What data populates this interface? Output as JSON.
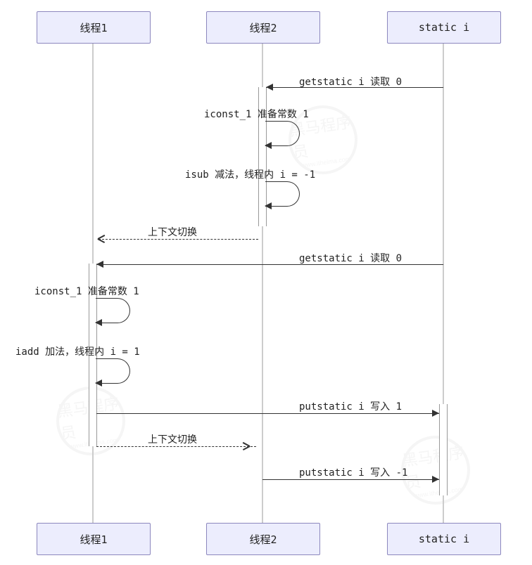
{
  "participants": {
    "p1": "线程1",
    "p2": "线程2",
    "p3": "static i"
  },
  "messages": {
    "m1": "getstatic i 读取 0",
    "m2": "iconst_1 准备常数 1",
    "m3": "isub 减法，线程内 i = -1",
    "m4": "上下文切换",
    "m5": "getstatic i 读取 0",
    "m6": "iconst_1 准备常数 1",
    "m7": "iadd 加法，线程内 i = 1",
    "m8": "putstatic i 写入 1",
    "m9": "上下文切换",
    "m10": "putstatic i 写入 -1"
  },
  "watermark": {
    "text1": "黑马程序员",
    "text2": "www.itheima.com"
  },
  "chart_data": {
    "type": "sequence-diagram",
    "participants": [
      {
        "id": "thread1",
        "label": "线程1"
      },
      {
        "id": "thread2",
        "label": "线程2"
      },
      {
        "id": "static_i",
        "label": "static i"
      }
    ],
    "messages": [
      {
        "from": "static_i",
        "to": "thread2",
        "label": "getstatic i 读取 0",
        "style": "solid"
      },
      {
        "from": "thread2",
        "to": "thread2",
        "label": "iconst_1 准备常数 1",
        "style": "self"
      },
      {
        "from": "thread2",
        "to": "thread2",
        "label": "isub 减法，线程内 i = -1",
        "style": "self"
      },
      {
        "from": "thread2",
        "to": "thread1",
        "label": "上下文切换",
        "style": "dashed"
      },
      {
        "from": "static_i",
        "to": "thread1",
        "label": "getstatic i 读取 0",
        "style": "solid"
      },
      {
        "from": "thread1",
        "to": "thread1",
        "label": "iconst_1 准备常数 1",
        "style": "self"
      },
      {
        "from": "thread1",
        "to": "thread1",
        "label": "iadd 加法，线程内 i = 1",
        "style": "self"
      },
      {
        "from": "thread1",
        "to": "static_i",
        "label": "putstatic i 写入 1",
        "style": "solid"
      },
      {
        "from": "thread1",
        "to": "thread2",
        "label": "上下文切换",
        "style": "dashed"
      },
      {
        "from": "thread2",
        "to": "static_i",
        "label": "putstatic i 写入 -1",
        "style": "solid"
      }
    ]
  }
}
